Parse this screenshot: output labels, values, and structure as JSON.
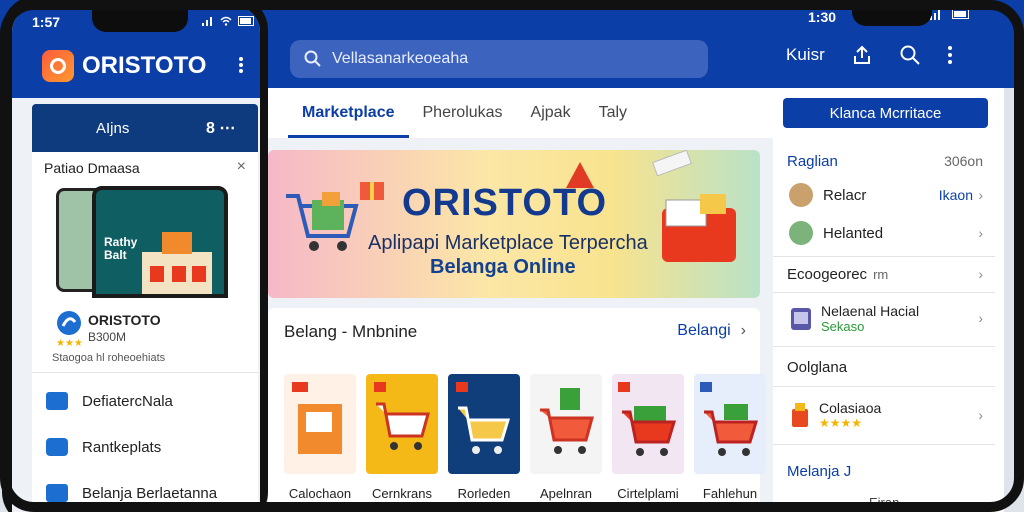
{
  "colors": {
    "brand": "#0c3ea8",
    "accent": "#ff5b3a",
    "star": "#f5b400"
  },
  "back_app": {
    "status": {
      "time": "1:30"
    },
    "search": {
      "value": "Vellasanarkeoeaha"
    },
    "header": {
      "label": "Kuisr"
    },
    "icons": [
      "share-icon",
      "search-icon",
      "more-vert-icon"
    ],
    "tabs": [
      "Marketplace",
      "Pherolukas",
      "Ajpak",
      "Taly"
    ],
    "cta": "Klanca Mcrritace",
    "banner": {
      "title": "ORISTOTO",
      "line1": "Aplipapi Marketplace Terpercha",
      "line2": "Belanga Online"
    },
    "section": {
      "title": "Belang - Mnbnine",
      "link": "Belangi",
      "products": [
        {
          "label": "Calochaon",
          "bg": "#fff1e6"
        },
        {
          "label": "Cernkrans",
          "bg": "#f5b917"
        },
        {
          "label": "Rorleden",
          "bg": "#0f3e7a"
        },
        {
          "label": "Apelnran",
          "bg": "#f4f4f4"
        },
        {
          "label": "Cirtelplami",
          "bg": "#f3e6f3"
        },
        {
          "label": "Fahlehun",
          "bg": "#e7eefb"
        }
      ]
    },
    "right": {
      "header_left": "Raglian",
      "header_right": "306on",
      "row1": {
        "label": "Relacr",
        "value": "Ikaon"
      },
      "row2": {
        "label": "Helanted"
      },
      "row3": {
        "label": "Ecoogeorec",
        "suffix": "rm"
      },
      "row4": {
        "label": "Nelaenal Hacial",
        "sub": "Sekaso"
      },
      "section2": "Oolglana",
      "row5": {
        "label": "Colasiaoa"
      },
      "section3": "Melanja J",
      "footer": "Eiran"
    }
  },
  "phone": {
    "status": {
      "time": "1:57"
    },
    "brand": "ORISTOTO",
    "card_title": "AIjns",
    "card_action": "8 ⋯",
    "modal": {
      "title": "Patiao Dmaasa",
      "screen_line1": "Rathy",
      "screen_line2": "Balt",
      "app_name": "ORISTOTO",
      "size": "B300M",
      "rating": "★★★",
      "desc": "Staogoa hl roheoehiats"
    },
    "menu": [
      "DefiatercNala",
      "Rantkeplats",
      "Belanja Berlaetanna"
    ]
  }
}
